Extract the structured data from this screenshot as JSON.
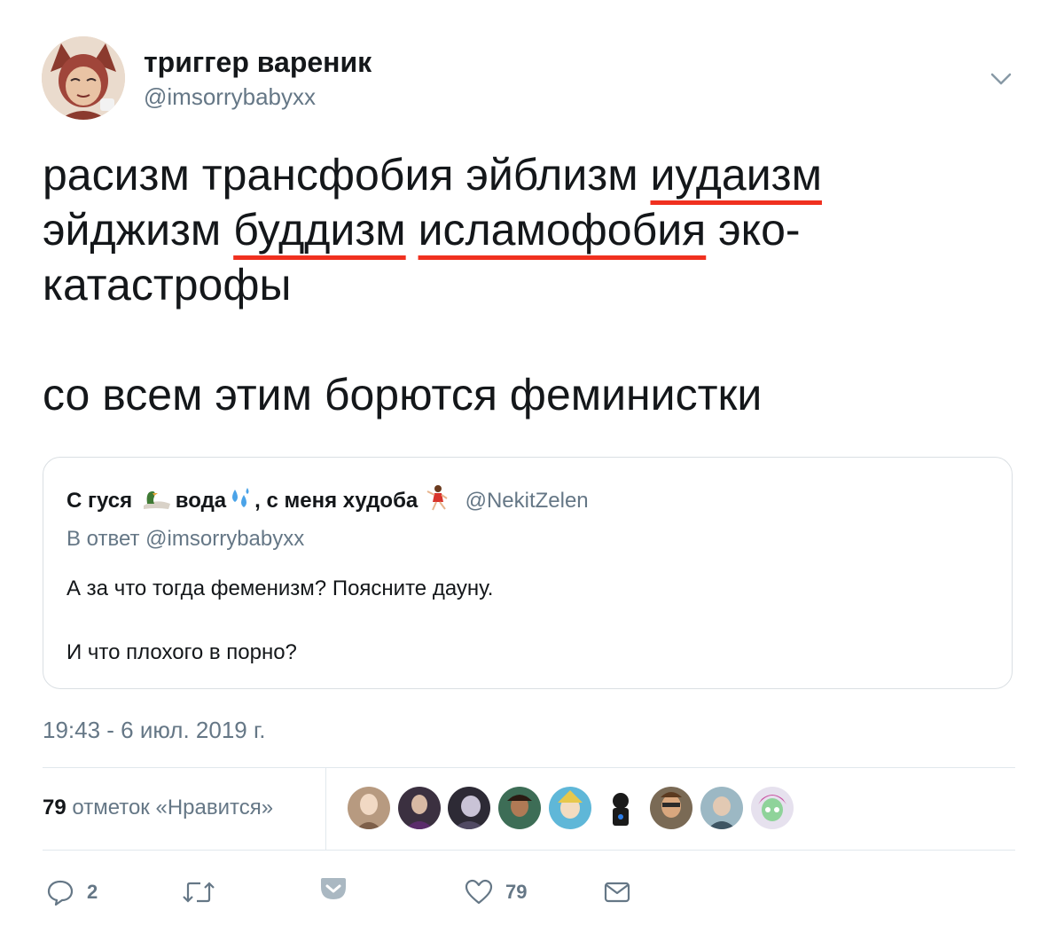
{
  "tweet": {
    "display_name": "триггер вареник",
    "handle": "@imsorrybabyxx",
    "text": {
      "line1_plain": "расизм трансфобия эйблизм ",
      "line1_underlined": "иудаизм",
      "line2_plain_a": "эйджизм ",
      "line2_underlined_a": "буддизм",
      "line2_space": " ",
      "line2_underlined_b": "исламофобия",
      "line2_plain_b": " эко-",
      "line3": "катастрофы",
      "line4": "со всем этим борются феминистки"
    },
    "timestamp": "19:43 - 6 июл. 2019 г.",
    "likes_count": "79",
    "likes_label": "отметок «Нравится»"
  },
  "quoted_tweet": {
    "name_part1": "С гуся",
    "name_part2": "вода",
    "name_part3": ", с меня худоба",
    "handle": "@NekitZelen",
    "reply_to": "В ответ @imsorrybabyxx",
    "body_line1": "А за что тогда феменизм? Поясните дауну.",
    "body_line2": "И что плохого в порно?"
  },
  "actions": {
    "reply_count": "2",
    "retweet_count": "",
    "like_count": "79",
    "icons": [
      "reply-icon",
      "retweet-icon",
      "pocket-icon",
      "heart-icon",
      "mail-icon"
    ]
  },
  "colors": {
    "underline": "#f0301f",
    "secondary_text": "#657786",
    "primary_text": "#14171a"
  }
}
